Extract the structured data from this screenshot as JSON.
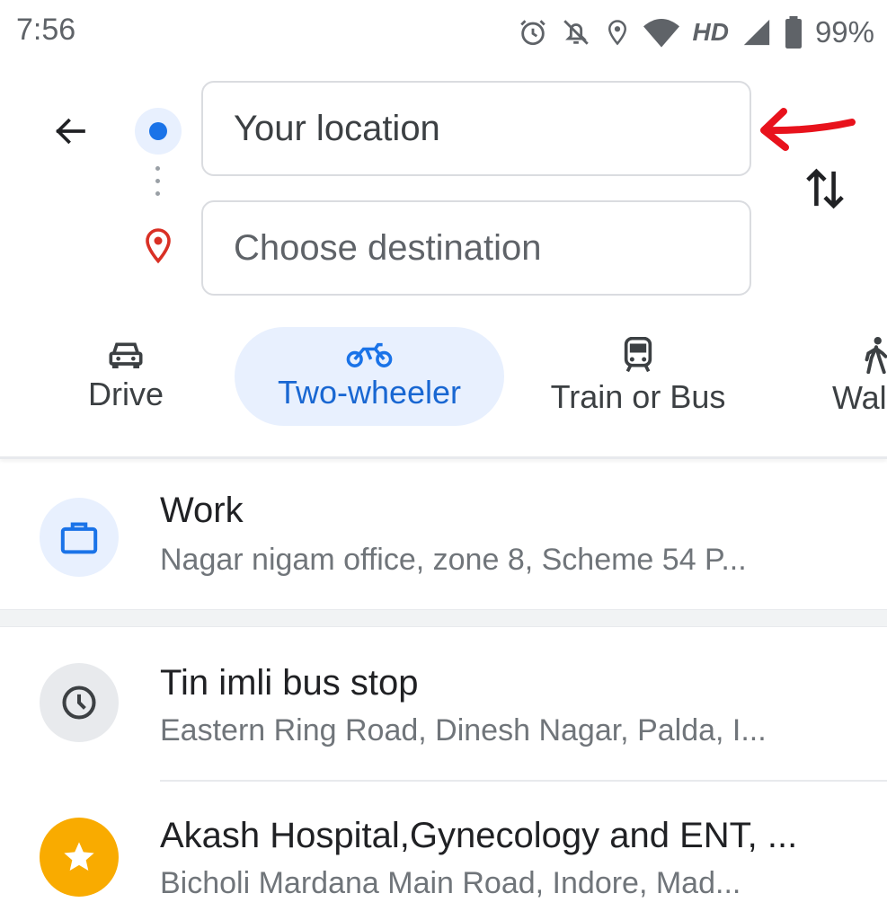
{
  "status_bar": {
    "time": "7:56",
    "network_label": "HD",
    "battery": "99%",
    "icons": [
      "alarm-icon",
      "notifications-off-icon",
      "location-icon",
      "wifi-icon",
      "cell-signal-icon",
      "battery-icon"
    ]
  },
  "search": {
    "origin_value": "Your location",
    "destination_placeholder": "Choose destination"
  },
  "modes": [
    {
      "label": "Drive",
      "icon": "car-icon"
    },
    {
      "label": "Two-wheeler",
      "icon": "motorcycle-icon",
      "selected": true
    },
    {
      "label": "Train or Bus",
      "icon": "train-icon"
    },
    {
      "label": "Wal",
      "icon": "walk-icon"
    }
  ],
  "saved_places": [
    {
      "title": "Work",
      "subtitle": "Nagar nigam office, zone 8, Scheme 54 P...",
      "icon": "briefcase-icon"
    }
  ],
  "recent_places": [
    {
      "title": "Tin imli bus stop",
      "subtitle": "Eastern Ring Road, Dinesh Nagar, Palda, I...",
      "icon": "history-icon"
    },
    {
      "title": "Akash Hospital,Gynecology and ENT, ...",
      "subtitle": "Bicholi Mardana Main Road, Indore, Mad...",
      "icon": "star-icon"
    }
  ],
  "colors": {
    "accent": "#1a73e8",
    "selected_chip_bg": "#e8f0fe",
    "destination_pin": "#d93025",
    "star_badge": "#f9ab00",
    "annotation_arrow": "#e8121c"
  }
}
